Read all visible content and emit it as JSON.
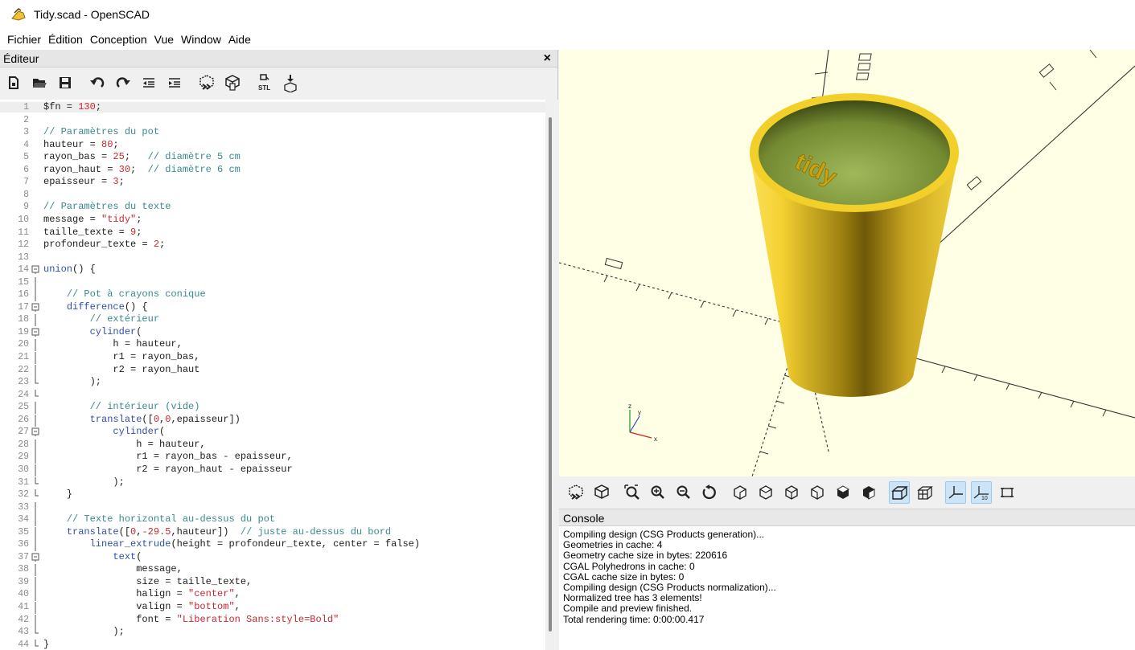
{
  "window": {
    "title": "Tidy.scad - OpenSCAD"
  },
  "menu": [
    "Fichier",
    "Édition",
    "Conception",
    "Vue",
    "Window",
    "Aide"
  ],
  "editor": {
    "header": "Éditeur",
    "close": "×",
    "toolbar": [
      "new-file-icon",
      "open-folder-icon",
      "save-icon",
      "undo-icon",
      "redo-icon",
      "unindent-icon",
      "indent-icon",
      "preview-icon",
      "render-icon",
      "export-stl-icon",
      "send-to-print-icon"
    ],
    "lines": [
      {
        "n": "1",
        "t": "$fn = 130;"
      },
      {
        "n": "2",
        "t": ""
      },
      {
        "n": "3",
        "t": "// Paramètres du pot"
      },
      {
        "n": "4",
        "t": "hauteur = 80;"
      },
      {
        "n": "5",
        "t": "rayon_bas = 25;   // diamètre 5 cm"
      },
      {
        "n": "6",
        "t": "rayon_haut = 30;  // diamètre 6 cm"
      },
      {
        "n": "7",
        "t": "epaisseur = 3;"
      },
      {
        "n": "8",
        "t": ""
      },
      {
        "n": "9",
        "t": "// Paramètres du texte"
      },
      {
        "n": "10",
        "t": "message = \"tidy\";"
      },
      {
        "n": "11",
        "t": "taille_texte = 9;"
      },
      {
        "n": "12",
        "t": "profondeur_texte = 2;"
      },
      {
        "n": "13",
        "t": ""
      },
      {
        "n": "14",
        "t": "union() {"
      },
      {
        "n": "15",
        "t": ""
      },
      {
        "n": "16",
        "t": "    // Pot à crayons conique"
      },
      {
        "n": "17",
        "t": "    difference() {"
      },
      {
        "n": "18",
        "t": "        // extérieur"
      },
      {
        "n": "19",
        "t": "        cylinder("
      },
      {
        "n": "20",
        "t": "            h = hauteur,"
      },
      {
        "n": "21",
        "t": "            r1 = rayon_bas,"
      },
      {
        "n": "22",
        "t": "            r2 = rayon_haut"
      },
      {
        "n": "23",
        "t": "        );"
      },
      {
        "n": "24",
        "t": ""
      },
      {
        "n": "25",
        "t": "        // intérieur (vide)"
      },
      {
        "n": "26",
        "t": "        translate([0,0,epaisseur])"
      },
      {
        "n": "27",
        "t": "            cylinder("
      },
      {
        "n": "28",
        "t": "                h = hauteur,"
      },
      {
        "n": "29",
        "t": "                r1 = rayon_bas - epaisseur,"
      },
      {
        "n": "30",
        "t": "                r2 = rayon_haut - epaisseur"
      },
      {
        "n": "31",
        "t": "            );"
      },
      {
        "n": "32",
        "t": "    }"
      },
      {
        "n": "33",
        "t": ""
      },
      {
        "n": "34",
        "t": "    // Texte horizontal au-dessus du pot"
      },
      {
        "n": "35",
        "t": "    translate([0,-29.5,hauteur])  // juste au-dessus du bord"
      },
      {
        "n": "36",
        "t": "        linear_extrude(height = profondeur_texte, center = false)"
      },
      {
        "n": "37",
        "t": "            text("
      },
      {
        "n": "38",
        "t": "                message,"
      },
      {
        "n": "39",
        "t": "                size = taille_texte,"
      },
      {
        "n": "40",
        "t": "                halign = \"center\","
      },
      {
        "n": "41",
        "t": "                valign = \"bottom\","
      },
      {
        "n": "42",
        "t": "                font = \"Liberation Sans:style=Bold\""
      },
      {
        "n": "43",
        "t": "            );"
      },
      {
        "n": "44",
        "t": "}"
      }
    ]
  },
  "viewport": {
    "text_on_model": "tidy",
    "axis_labels": {
      "z": "z",
      "y": "y",
      "x": "x"
    },
    "colors": {
      "background": "#ffffe5",
      "model": "#f5d132",
      "model_inner": "#8fa84a"
    }
  },
  "view_toolbar": [
    "preview-icon",
    "render-icon",
    "view-all-icon",
    "zoom-in-icon",
    "zoom-out-icon",
    "reset-view-icon",
    "view-right-icon",
    "view-top-icon",
    "view-bottom-icon",
    "view-left-icon",
    "view-front-icon",
    "view-back-icon",
    "perspective-icon",
    "orthogonal-icon",
    "show-axes-icon",
    "show-scale-markers-icon",
    "show-edges-icon"
  ],
  "view_toolbar_scale_label": "10",
  "console": {
    "header": "Console",
    "lines": [
      "Compiling design (CSG Products generation)...",
      "Geometries in cache: 4",
      "Geometry cache size in bytes: 220616",
      "CGAL Polyhedrons in cache: 0",
      "CGAL cache size in bytes: 0",
      "Compiling design (CSG Products normalization)...",
      "Normalized tree has 3 elements!",
      "Compile and preview finished.",
      "Total rendering time: 0:00:00.417"
    ]
  }
}
